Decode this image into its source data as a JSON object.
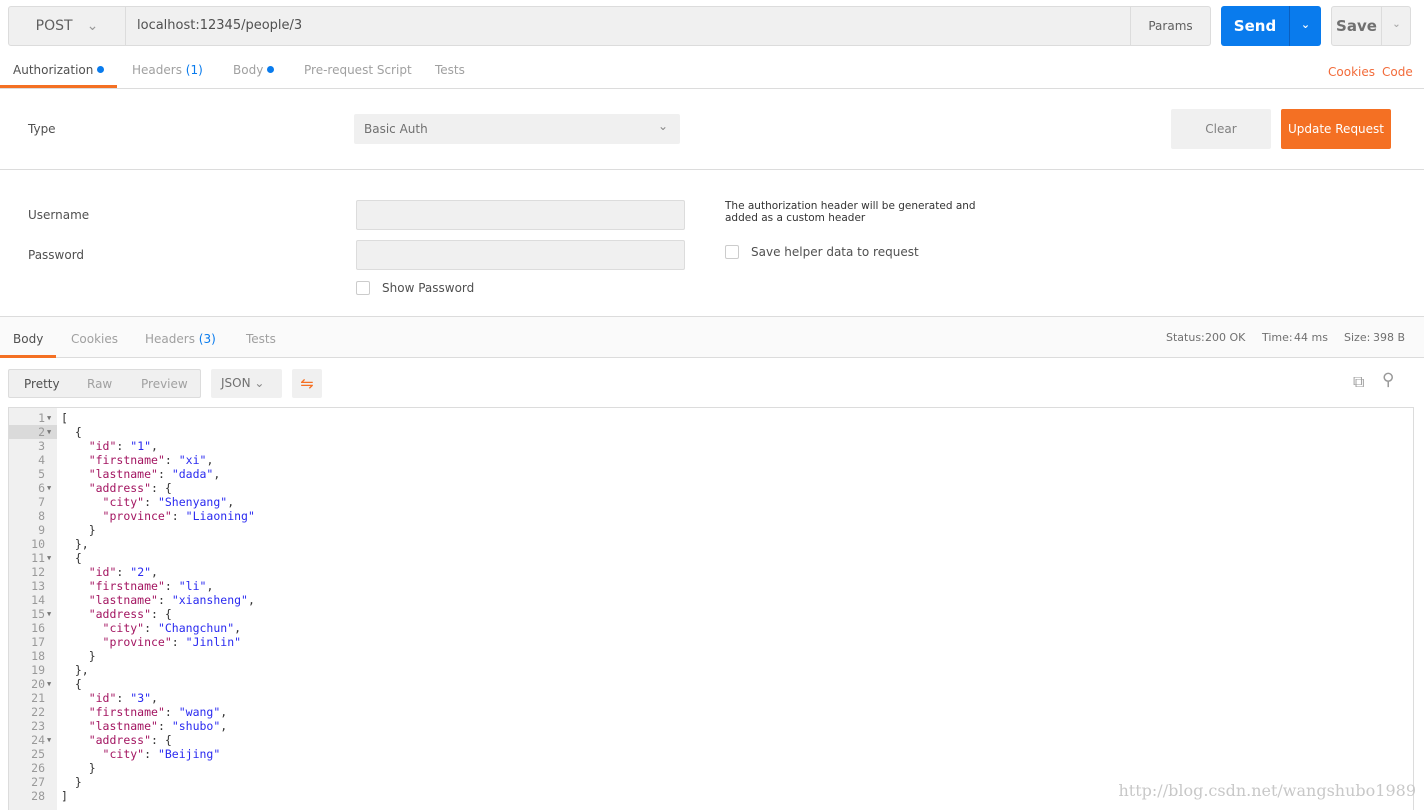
{
  "request": {
    "method": "POST",
    "url": "localhost:12345/people/3",
    "params_label": "Params",
    "send_label": "Send",
    "save_label": "Save"
  },
  "request_tabs": [
    {
      "label": "Authorization",
      "dot": true
    },
    {
      "label": "Headers",
      "count": "(1)"
    },
    {
      "label": "Body",
      "dot": true
    },
    {
      "label": "Pre-request Script"
    },
    {
      "label": "Tests"
    }
  ],
  "links": {
    "cookies": "Cookies",
    "code": "Code"
  },
  "auth": {
    "type_label": "Type",
    "type_value": "Basic Auth",
    "clear_label": "Clear",
    "update_label": "Update Request",
    "username_label": "Username",
    "password_label": "Password",
    "username_value": "",
    "password_value": "",
    "show_password_label": "Show Password",
    "info_line1": "The authorization header will be generated and",
    "info_line2": "added as a custom header",
    "save_helper_label": "Save helper data to request"
  },
  "response_tabs": [
    {
      "label": "Body"
    },
    {
      "label": "Cookies"
    },
    {
      "label": "Headers",
      "count": "(3)"
    },
    {
      "label": "Tests"
    }
  ],
  "status": {
    "status_label": "Status:",
    "status_value": "200 OK",
    "time_label": "Time:",
    "time_value": "44 ms",
    "size_label": "Size:",
    "size_value": "398 B"
  },
  "view": {
    "pretty": "Pretty",
    "raw": "Raw",
    "preview": "Preview",
    "format": "JSON"
  },
  "code_lines": [
    "[",
    "  {",
    "    \"id\": \"1\",",
    "    \"firstname\": \"xi\",",
    "    \"lastname\": \"dada\",",
    "    \"address\": {",
    "      \"city\": \"Shenyang\",",
    "      \"province\": \"Liaoning\"",
    "    }",
    "  },",
    "  {",
    "    \"id\": \"2\",",
    "    \"firstname\": \"li\",",
    "    \"lastname\": \"xiansheng\",",
    "    \"address\": {",
    "      \"city\": \"Changchun\",",
    "      \"province\": \"Jinlin\"",
    "    }",
    "  },",
    "  {",
    "    \"id\": \"3\",",
    "    \"firstname\": \"wang\",",
    "    \"lastname\": \"shubo\",",
    "    \"address\": {",
    "      \"city\": \"Beijing\"",
    "    }",
    "  }",
    "]"
  ],
  "fold_lines": [
    1,
    2,
    6,
    11,
    15,
    20,
    24
  ],
  "watermark": "http://blog.csdn.net/wangshubo1989"
}
